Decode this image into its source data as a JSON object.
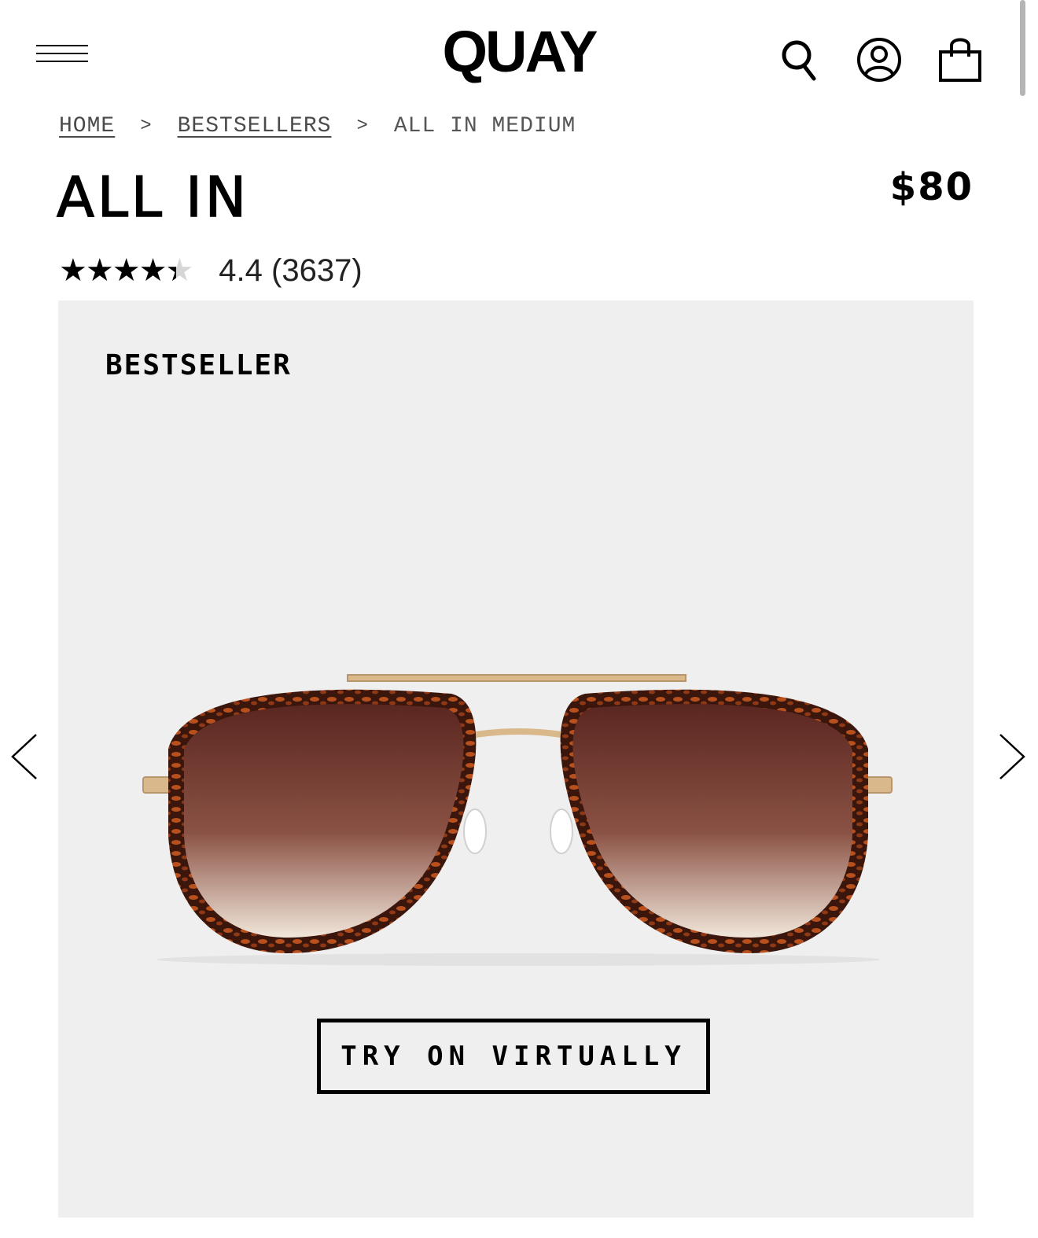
{
  "header": {
    "brand": "QUAY",
    "icons": [
      "hamburger-menu-icon",
      "search-icon",
      "account-icon",
      "shopping-bag-icon"
    ]
  },
  "breadcrumb": {
    "items": [
      {
        "label": "HOME",
        "link": true
      },
      {
        "label": "BESTSELLERS",
        "link": true
      },
      {
        "label": "ALL IN MEDIUM",
        "link": false
      }
    ],
    "separator": ">"
  },
  "product": {
    "title": "ALL IN",
    "price": "$80",
    "rating": {
      "value": 4.4,
      "text": "4.4 (3637)",
      "max": 5
    },
    "badge": "BESTSELLER",
    "try_on_label": "TRY ON VIRTUALLY"
  },
  "gallery": {
    "prev_icon": "chevron-left-icon",
    "next_icon": "chevron-right-icon"
  },
  "colors": {
    "text": "#000000",
    "gallery_bg": "#efefef",
    "breadcrumb": "#4a4a4a",
    "frame_tortoise": "#6b2614",
    "lens_brown": "#5e2a22",
    "metal_gold": "#d9b98c"
  }
}
